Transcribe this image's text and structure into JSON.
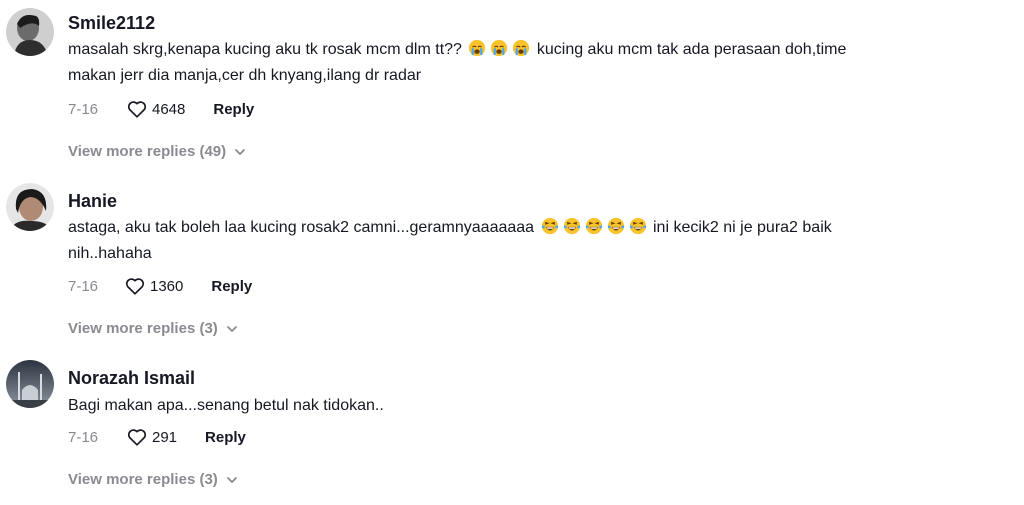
{
  "comments": [
    {
      "username": "Smile2112",
      "text_line1a": "masalah skrg,kenapa kucing aku tk rosak mcm dlm tt??",
      "text_line1b": "kucing aku mcm tak ada perasaan doh,time",
      "text_line2": "makan jerr dia manja,cer dh knyang,ilang dr radar",
      "emojis_1": [
        "crying-face-icon",
        "crying-face-icon",
        "crying-face-icon"
      ],
      "date": "7-16",
      "likes": "4648",
      "reply_label": "Reply",
      "more_replies": "View more replies (49)"
    },
    {
      "username": "Hanie",
      "text_line1a": "astaga, aku tak boleh laa kucing rosak2 camni...geramnyaaaaaaa",
      "text_line1b": "ini kecik2 ni je pura2 baik",
      "text_line2": "nih..hahaha",
      "emojis_1": [
        "laughing-face-icon",
        "laughing-face-icon",
        "laughing-face-icon",
        "laughing-face-icon",
        "laughing-face-icon"
      ],
      "date": "7-16",
      "likes": "1360",
      "reply_label": "Reply",
      "more_replies": "View more replies (3)"
    },
    {
      "username": "Norazah Ismail",
      "text_line1": "Bagi makan apa...senang betul nak tidokan..",
      "date": "7-16",
      "likes": "291",
      "reply_label": "Reply",
      "more_replies": "View more replies (3)"
    }
  ]
}
